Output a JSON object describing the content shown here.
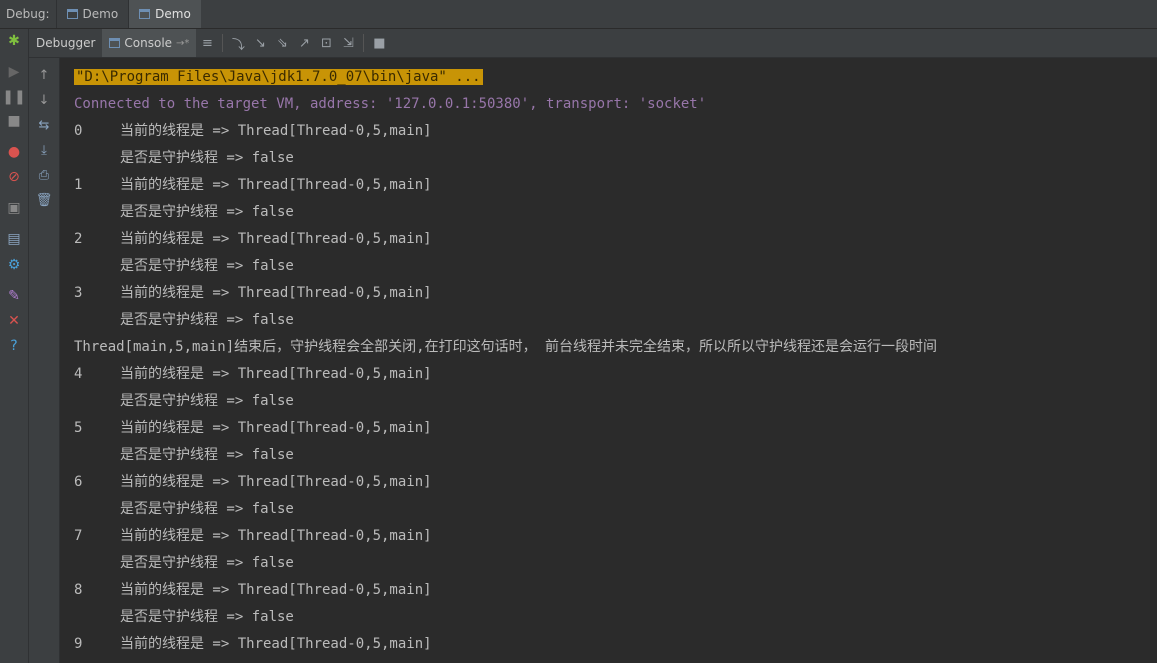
{
  "topbar": {
    "debug_label": "Debug:",
    "tabs": [
      {
        "label": "Demo"
      },
      {
        "label": "Demo",
        "active": true
      }
    ]
  },
  "toolbar": {
    "debugger_tab": "Debugger",
    "console_tab": "Console",
    "console_suffix": "→*"
  },
  "console": {
    "command_line": "\"D:\\Program Files\\Java\\jdk1.7.0_07\\bin\\java\" ...",
    "connected_line": "Connected to the target VM, address: '127.0.0.1:50380', transport: 'socket'",
    "main_end_line": "Thread[main,5,main]结束后，守护线程会全部关闭,在打印这句话时， 前台线程并未完全结束，所以所以守护线程还是会运行一段时间",
    "thread_text": "当前的线程是 => Thread[Thread-0,5,main]",
    "daemon_text": "是否是守护线程 => false",
    "entries": [
      "0",
      "1",
      "2",
      "3",
      "4",
      "5",
      "6",
      "7",
      "8",
      "9"
    ]
  },
  "colors": {
    "background": "#2b2b2b",
    "panel": "#3c3f41",
    "highlight": "#c89406",
    "info_text": "#9876aa",
    "output_text": "#bbbbbb"
  }
}
